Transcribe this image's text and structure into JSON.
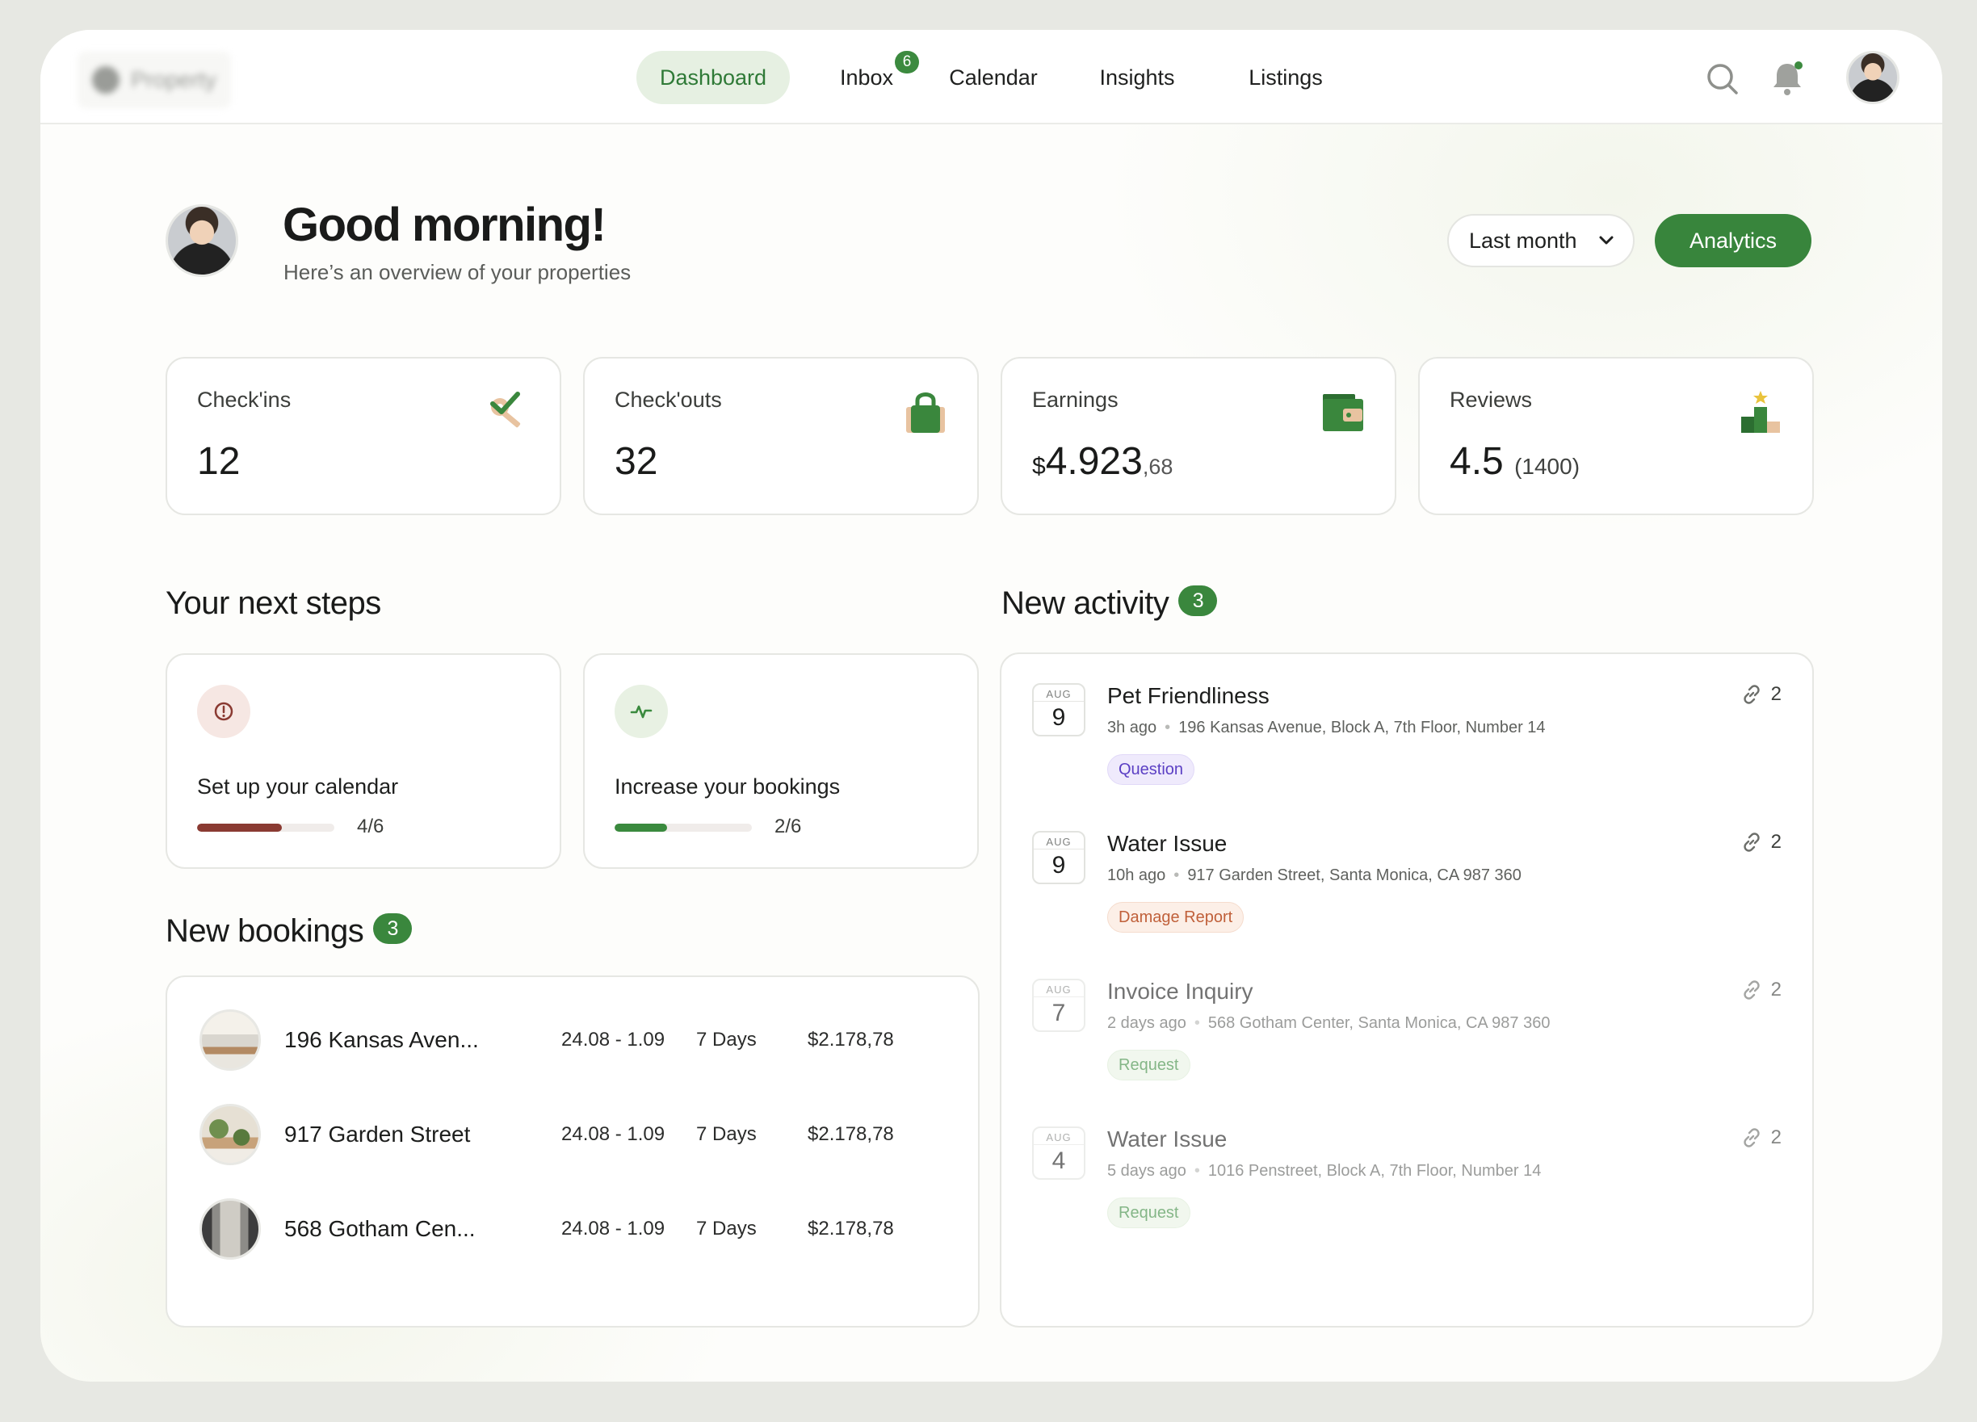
{
  "nav": {
    "logo_text": "Property",
    "items": [
      {
        "label": "Dashboard"
      },
      {
        "label": "Inbox",
        "badge": "6"
      },
      {
        "label": "Calendar"
      },
      {
        "label": "Insights"
      },
      {
        "label": "Listings"
      }
    ],
    "icons": [
      "search-icon",
      "bell-icon",
      "user-avatar"
    ]
  },
  "greeting": {
    "title": "Good morning!",
    "subtitle": "Here’s an overview of your properties"
  },
  "controls": {
    "period": "Last month",
    "analytics_label": "Analytics"
  },
  "stats": {
    "checkins": {
      "label": "Check'ins",
      "value": "12",
      "icon": "key-check-icon"
    },
    "checkouts": {
      "label": "Check'outs",
      "value": "32",
      "icon": "bag-icon"
    },
    "earnings": {
      "label": "Earnings",
      "currency": "$",
      "value": "4.923",
      "cents": ",68",
      "icon": "wallet-icon"
    },
    "reviews": {
      "label": "Reviews",
      "value": "4.5",
      "count": "(1400)",
      "icon": "podium-icon"
    }
  },
  "next_steps": {
    "title": "Your next steps",
    "items": [
      {
        "title": "Set up your calendar",
        "progress": "4/6",
        "fraction": 0.62,
        "icon": "alert-icon",
        "color": "#8a3a32"
      },
      {
        "title": "Increase your bookings",
        "progress": "2/6",
        "fraction": 0.38,
        "icon": "pulse-icon",
        "color": "#3a8a3e"
      }
    ]
  },
  "bookings": {
    "title": "New bookings",
    "count": "3",
    "rows": [
      {
        "name": "196 Kansas Aven...",
        "dates": "24.08 - 1.09",
        "days": "7 Days",
        "price": "$2.178,78"
      },
      {
        "name": "917 Garden Street",
        "dates": "24.08 - 1.09",
        "days": "7 Days",
        "price": "$2.178,78"
      },
      {
        "name": "568 Gotham Cen...",
        "dates": "24.08 - 1.09",
        "days": "7 Days",
        "price": "$2.178,78"
      }
    ]
  },
  "activity": {
    "title": "New activity",
    "count": "3",
    "items": [
      {
        "month": "AUG",
        "day": "9",
        "title": "Pet Friendliness",
        "time": "3h ago",
        "address": "196 Kansas Avenue, Block A, 7th Floor, Number 14",
        "tag": "Question",
        "links": "2"
      },
      {
        "month": "AUG",
        "day": "9",
        "title": "Water Issue",
        "time": "10h ago",
        "address": "917 Garden Street, Santa Monica, CA 987 360",
        "tag": "Damage Report",
        "links": "2"
      },
      {
        "month": "AUG",
        "day": "7",
        "title": "Invoice Inquiry",
        "time": "2 days ago",
        "address": "568 Gotham Center, Santa Monica, CA 987 360",
        "tag": "Request",
        "links": "2"
      },
      {
        "month": "AUG",
        "day": "4",
        "title": "Water Issue",
        "time": "5 days ago",
        "address": "1016 Penstreet, Block A, 7th Floor, Number 14",
        "tag": "Request",
        "links": "2"
      }
    ]
  },
  "colors": {
    "accent": "#38853c",
    "accent_soft": "#e6f0e2",
    "alert": "#8a3a32",
    "question_tag": "#5b3fc4",
    "damage_tag": "#c0603a",
    "request_tag": "#3a8a3e"
  }
}
